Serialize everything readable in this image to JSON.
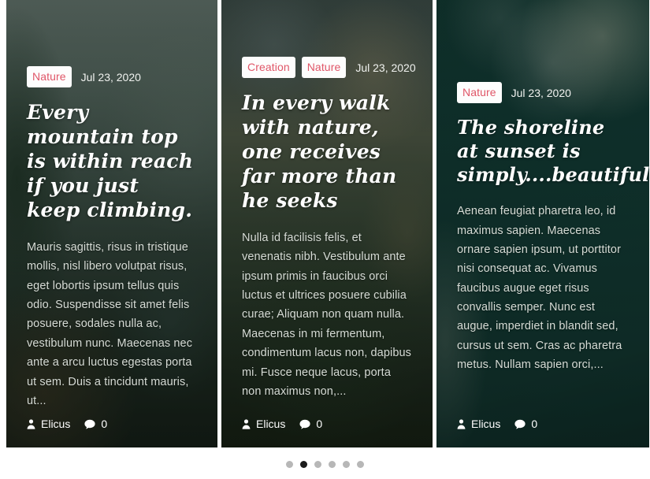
{
  "carousel": {
    "slides": [
      {
        "tags": [
          "Nature"
        ],
        "date": "Jul 23, 2020",
        "title": "Every mountain top is within reach if you just keep climbing.",
        "excerpt": "Mauris sagittis, risus in tristique mollis, nisl libero volutpat risus, eget lobortis ipsum tellus quis odio. Suspendisse sit amet felis posuere, sodales nulla ac, vestibulum nunc. Maecenas nec ante a arcu luctus egestas porta ut sem. Duis a tincidunt mauris, ut...",
        "author": "Elicus",
        "comments": "0"
      },
      {
        "tags": [
          "Creation",
          "Nature"
        ],
        "date": "Jul 23, 2020",
        "title": "In every walk with nature, one receives far more than he seeks",
        "excerpt": "Nulla id facilisis felis, et venenatis nibh. Vestibulum ante ipsum primis in faucibus orci luctus et ultrices posuere cubilia curae; Aliquam non quam nulla. Maecenas in mi fermentum, condimentum lacus non, dapibus mi. Fusce neque lacus, porta non maximus non,...",
        "author": "Elicus",
        "comments": "0"
      },
      {
        "tags": [
          "Nature"
        ],
        "date": "Jul 23, 2020",
        "title": "The shoreline at sunset is simply....beautiful.",
        "excerpt": "Aenean feugiat pharetra leo, id maximus sapien. Maecenas ornare sapien ipsum, ut porttitor nisi consequat ac. Vivamus faucibus augue eget risus convallis semper. Nunc est augue, imperdiet in blandit sed, cursus ut sem. Cras ac pharetra metus. Nullam sapien orci,...",
        "author": "Elicus",
        "comments": "0"
      }
    ],
    "pagination": {
      "total": 6,
      "active_index": 1,
      "active_color": "#1b1b1b",
      "inactive_color": "#b7b7b7"
    },
    "icons": {
      "author": "user-icon",
      "comments": "comment-bubble-icon"
    },
    "colors": {
      "tag_text": "#e05668",
      "tag_background": "#fdfdfd",
      "title_text": "#ffffff",
      "excerpt_text": "#d6dbd5"
    }
  }
}
